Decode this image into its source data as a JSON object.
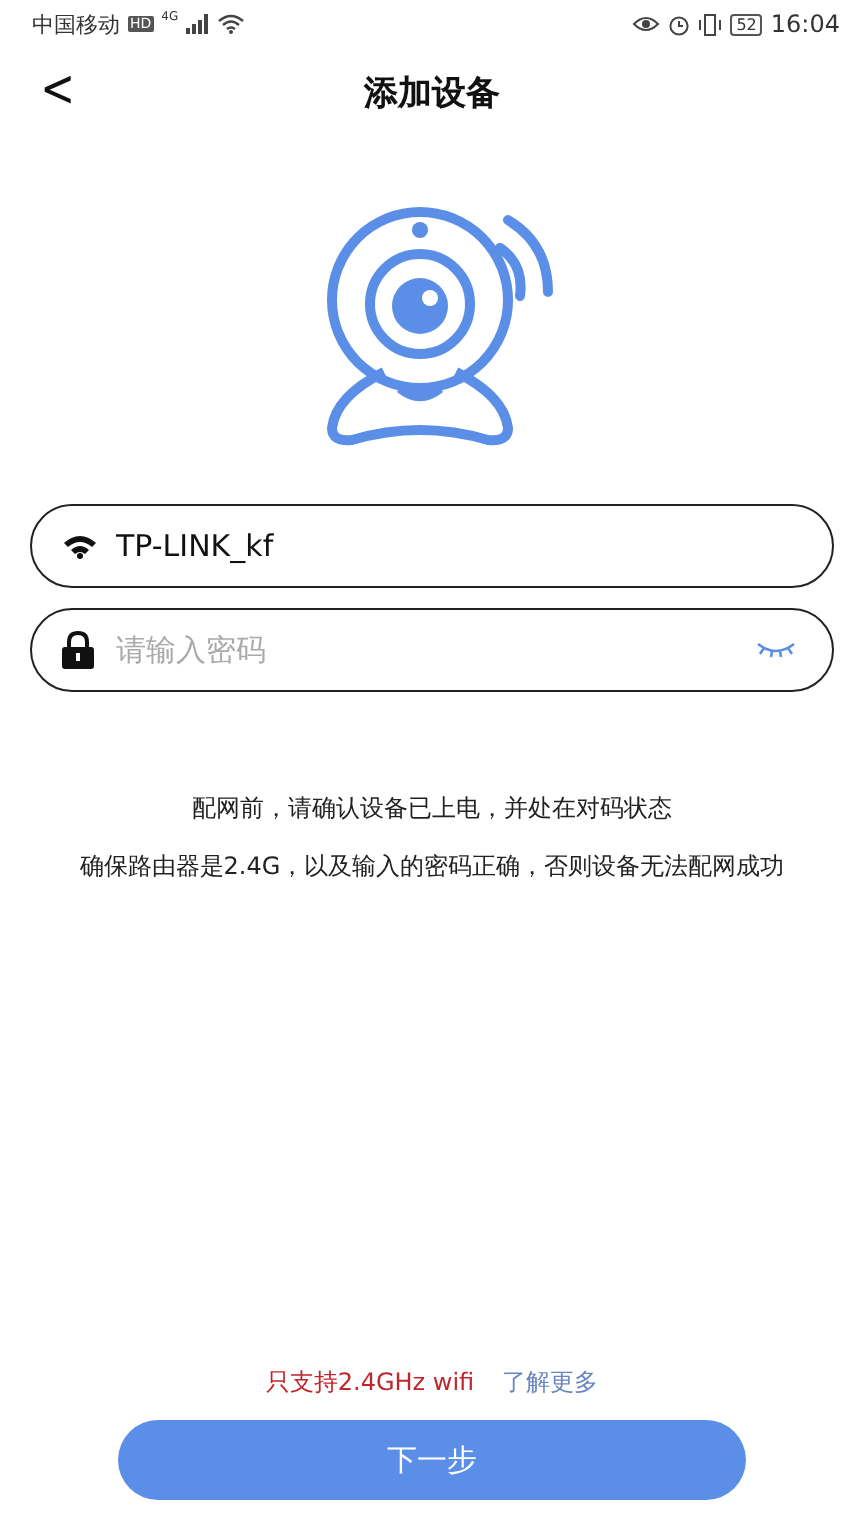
{
  "status_bar": {
    "carrier": "中国移动",
    "hd": "HD",
    "network": "4G",
    "battery": "52",
    "time": "16:04"
  },
  "header": {
    "back": "<",
    "title": "添加设备"
  },
  "wifi_field": {
    "value": "TP-LINK_kf"
  },
  "password_field": {
    "placeholder": "请输入密码",
    "visible": false
  },
  "notes": [
    "配网前，请确认设备已上电，并处在对码状态",
    "确保路由器是2.4G，以及输入的密码正确，否则设备无法配网成功"
  ],
  "footer": {
    "warning": "只支持2.4GHz wifi",
    "link": "了解更多"
  },
  "next_button": "下一步"
}
